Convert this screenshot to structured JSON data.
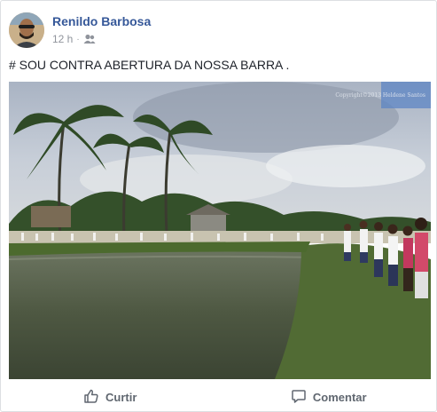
{
  "post": {
    "author_name": "Renildo Barbosa",
    "timestamp": "12 h",
    "separator": "·",
    "audience_icon": "friends-icon",
    "text": "# SOU CONTRA ABERTURA DA NOSSA BARRA .",
    "photo": {
      "watermark": "Copyright©2013 Heldene Santos"
    }
  },
  "actions": {
    "like_label": "Curtir",
    "like_icon": "thumbs-up-icon",
    "comment_label": "Comentar",
    "comment_icon": "comment-icon"
  },
  "colors": {
    "author_link": "#365899",
    "meta_text": "#90949c",
    "action_text": "#606770",
    "border": "#dddfe2"
  }
}
